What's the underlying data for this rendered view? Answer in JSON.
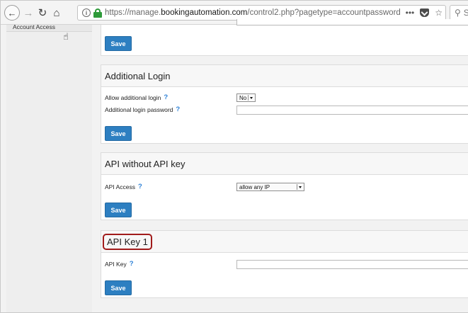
{
  "browser": {
    "url_prefix": "https://manage.",
    "url_host": "bookingautomation.com",
    "url_suffix": "/control2.php?pagetype=accountpassword",
    "more_label": "•••",
    "search_placeholder": "S"
  },
  "sidebar": {
    "items": [
      {
        "label": "Account Access"
      }
    ]
  },
  "panels": {
    "top": {
      "save_label": "Save"
    },
    "additional_login": {
      "title": "Additional Login",
      "allow_label": "Allow additional login",
      "allow_value": "No",
      "password_label": "Additional login password",
      "save_label": "Save"
    },
    "api_without_key": {
      "title": "API without API key",
      "access_label": "API Access",
      "access_value": "allow any IP",
      "save_label": "Save"
    },
    "api_key_1": {
      "title": "API Key 1",
      "key_label": "API Key",
      "save_label": "Save"
    }
  },
  "help_glyph": "?"
}
